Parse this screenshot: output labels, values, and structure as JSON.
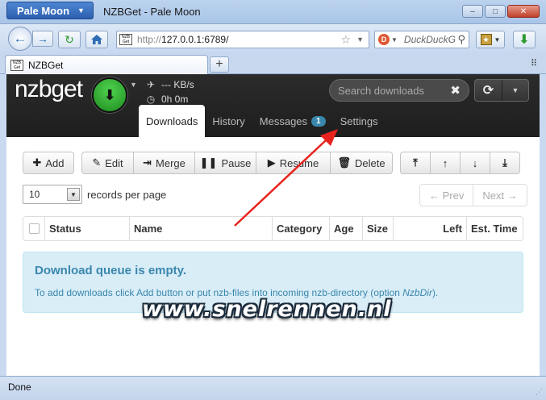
{
  "window": {
    "app_menu_label": "Pale Moon",
    "title": "NZBGet - Pale Moon",
    "minimize": "–",
    "maximize": "□",
    "close": "✕"
  },
  "nav": {
    "url_favicon_text": "NZB Get",
    "url_protocol": "http://",
    "url_host": "127.0.0.1:6789/",
    "search_engine_placeholder": "DuckDuckG"
  },
  "tabbar": {
    "tab_label": "NZBGet",
    "tab_favicon_text": "NZB Get",
    "new_tab": "+"
  },
  "app": {
    "logo_left": "nz",
    "logo_mid": "b",
    "logo_right": "get",
    "speed": "--- KB/s",
    "remaining": "0h 0m",
    "search_placeholder": "Search downloads",
    "tabs": [
      {
        "label": "Downloads",
        "active": true
      },
      {
        "label": "History",
        "active": false
      },
      {
        "label": "Messages",
        "badge": "1",
        "active": false
      },
      {
        "label": "Settings",
        "active": false
      }
    ]
  },
  "toolbar": {
    "add": "Add",
    "edit": "Edit",
    "merge": "Merge",
    "pause": "Pause",
    "resume": "Resume",
    "delete": "Delete"
  },
  "paging": {
    "records_value": "10",
    "records_label": "records per page",
    "prev": "← Prev",
    "next": "Next →"
  },
  "table": {
    "columns": [
      "Status",
      "Name",
      "Category",
      "Age",
      "Size",
      "Left",
      "Est. Time"
    ]
  },
  "queue_alert": {
    "title": "Download queue is empty.",
    "text_before": "To add downloads click Add button or put nzb-files into incoming nzb-directory (option ",
    "option_name": "NzbDir",
    "text_after": ")."
  },
  "watermark": "www.snelrennen.nl",
  "status_bar": {
    "text": "Done"
  },
  "colors": {
    "annotation_arrow": "#e8231d",
    "alert_text": "#3a87ad",
    "alert_bg": "#d9edf7",
    "badge": "#3a87ad",
    "speed_button": "#2fae2f"
  }
}
